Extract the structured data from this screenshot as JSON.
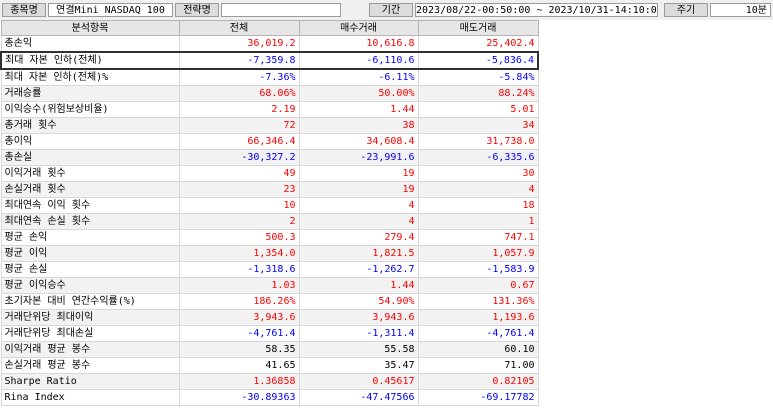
{
  "header": {
    "symbol_label": "종목명",
    "symbol_value": "연결Mini NASDAQ 100",
    "strategy_label": "전략명",
    "strategy_value": "",
    "period_label": "기간",
    "period_value": "2023/08/22-00:50:00 ~ 2023/10/31-14:10:00",
    "cycle_label": "주기",
    "cycle_value": "10분"
  },
  "table": {
    "columns": [
      "분석항목",
      "전체",
      "매수거래",
      "매도거래"
    ],
    "rows": [
      {
        "label": "총손익",
        "values": [
          "36,019.2",
          "10,616.8",
          "25,402.4"
        ],
        "signs": [
          "pos",
          "pos",
          "pos"
        ]
      },
      {
        "label": "최대 자본 인하(전체)",
        "values": [
          "-7,359.8",
          "-6,110.6",
          "-5,836.4"
        ],
        "signs": [
          "neg",
          "neg",
          "neg"
        ]
      },
      {
        "label": "최대 자본 인하(전체)%",
        "values": [
          "-7.36%",
          "-6.11%",
          "-5.84%"
        ],
        "signs": [
          "neg",
          "neg",
          "neg"
        ]
      },
      {
        "label": "거래승률",
        "values": [
          "68.06%",
          "50.00%",
          "88.24%"
        ],
        "signs": [
          "pos",
          "pos",
          "pos"
        ]
      },
      {
        "label": "이익승수(위험보상비율)",
        "values": [
          "2.19",
          "1.44",
          "5.01"
        ],
        "signs": [
          "pos",
          "pos",
          "pos"
        ]
      },
      {
        "label": "총거래 횟수",
        "values": [
          "72",
          "38",
          "34"
        ],
        "signs": [
          "pos",
          "pos",
          "pos"
        ]
      },
      {
        "label": "총이익",
        "values": [
          "66,346.4",
          "34,608.4",
          "31,738.0"
        ],
        "signs": [
          "pos",
          "pos",
          "pos"
        ]
      },
      {
        "label": "총손실",
        "values": [
          "-30,327.2",
          "-23,991.6",
          "-6,335.6"
        ],
        "signs": [
          "neg",
          "neg",
          "neg"
        ]
      },
      {
        "label": "이익거래 횟수",
        "values": [
          "49",
          "19",
          "30"
        ],
        "signs": [
          "pos",
          "pos",
          "pos"
        ]
      },
      {
        "label": "손실거래 횟수",
        "values": [
          "23",
          "19",
          "4"
        ],
        "signs": [
          "pos",
          "pos",
          "pos"
        ]
      },
      {
        "label": "최대연속 이익 횟수",
        "values": [
          "10",
          "4",
          "18"
        ],
        "signs": [
          "pos",
          "pos",
          "pos"
        ]
      },
      {
        "label": "최대연속 손실 횟수",
        "values": [
          "2",
          "4",
          "1"
        ],
        "signs": [
          "pos",
          "pos",
          "pos"
        ]
      },
      {
        "label": "평균 손익",
        "values": [
          "500.3",
          "279.4",
          "747.1"
        ],
        "signs": [
          "pos",
          "pos",
          "pos"
        ]
      },
      {
        "label": "평균 이익",
        "values": [
          "1,354.0",
          "1,821.5",
          "1,057.9"
        ],
        "signs": [
          "pos",
          "pos",
          "pos"
        ]
      },
      {
        "label": "평균 손실",
        "values": [
          "-1,318.6",
          "-1,262.7",
          "-1,583.9"
        ],
        "signs": [
          "neg",
          "neg",
          "neg"
        ]
      },
      {
        "label": "평균 이익승수",
        "values": [
          "1.03",
          "1.44",
          "0.67"
        ],
        "signs": [
          "pos",
          "pos",
          "pos"
        ]
      },
      {
        "label": "초기자본 대비 연간수익률(%)",
        "values": [
          "186.26%",
          "54.90%",
          "131.36%"
        ],
        "signs": [
          "pos",
          "pos",
          "pos"
        ]
      },
      {
        "label": "거래단위당 최대이익",
        "values": [
          "3,943.6",
          "3,943.6",
          "1,193.6"
        ],
        "signs": [
          "pos",
          "pos",
          "pos"
        ]
      },
      {
        "label": "거래단위당 최대손실",
        "values": [
          "-4,761.4",
          "-1,311.4",
          "-4,761.4"
        ],
        "signs": [
          "neg",
          "neg",
          "neg"
        ]
      },
      {
        "label": "이익거래 평균 봉수",
        "values": [
          "58.35",
          "55.58",
          "60.10"
        ],
        "signs": [
          "zero",
          "zero",
          "zero"
        ]
      },
      {
        "label": "손실거래 평균 봉수",
        "values": [
          "41.65",
          "35.47",
          "71.00"
        ],
        "signs": [
          "zero",
          "zero",
          "zero"
        ]
      },
      {
        "label": "Sharpe Ratio",
        "values": [
          "1.36858",
          "0.45617",
          "0.82105"
        ],
        "signs": [
          "pos",
          "pos",
          "pos"
        ]
      },
      {
        "label": "Rina Index",
        "values": [
          "-30.89363",
          "-47.47566",
          "-69.17782"
        ],
        "signs": [
          "neg",
          "neg",
          "neg"
        ]
      }
    ],
    "selected_row": 1
  },
  "colors": {
    "positive": "#ff0000",
    "negative": "#0000ff",
    "neutral": "#000000"
  }
}
